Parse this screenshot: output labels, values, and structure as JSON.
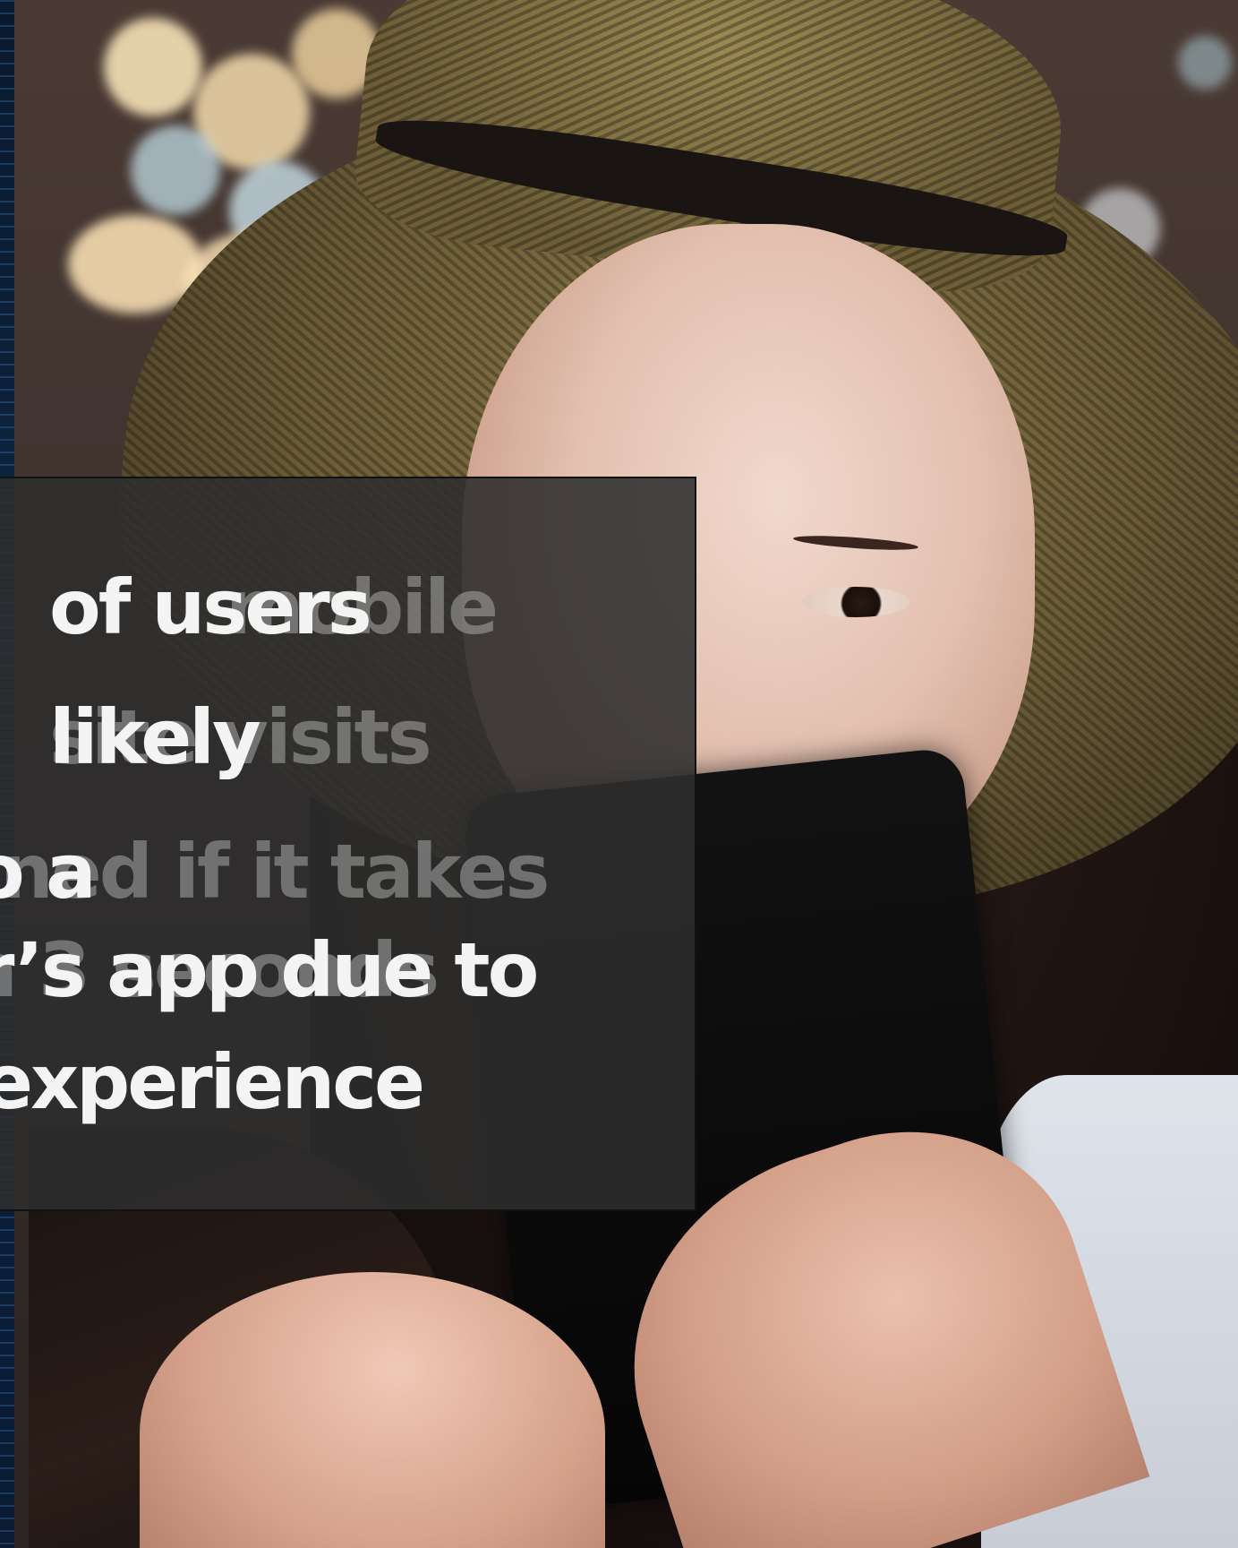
{
  "overlay": {
    "headline_lines": [
      "of users",
      "likely",
      "o a",
      "r’s app due to",
      "experience"
    ],
    "ghost_lines": [
      "mobile",
      "site visits",
      "ned if it takes",
      "n 3 seconds"
    ]
  }
}
